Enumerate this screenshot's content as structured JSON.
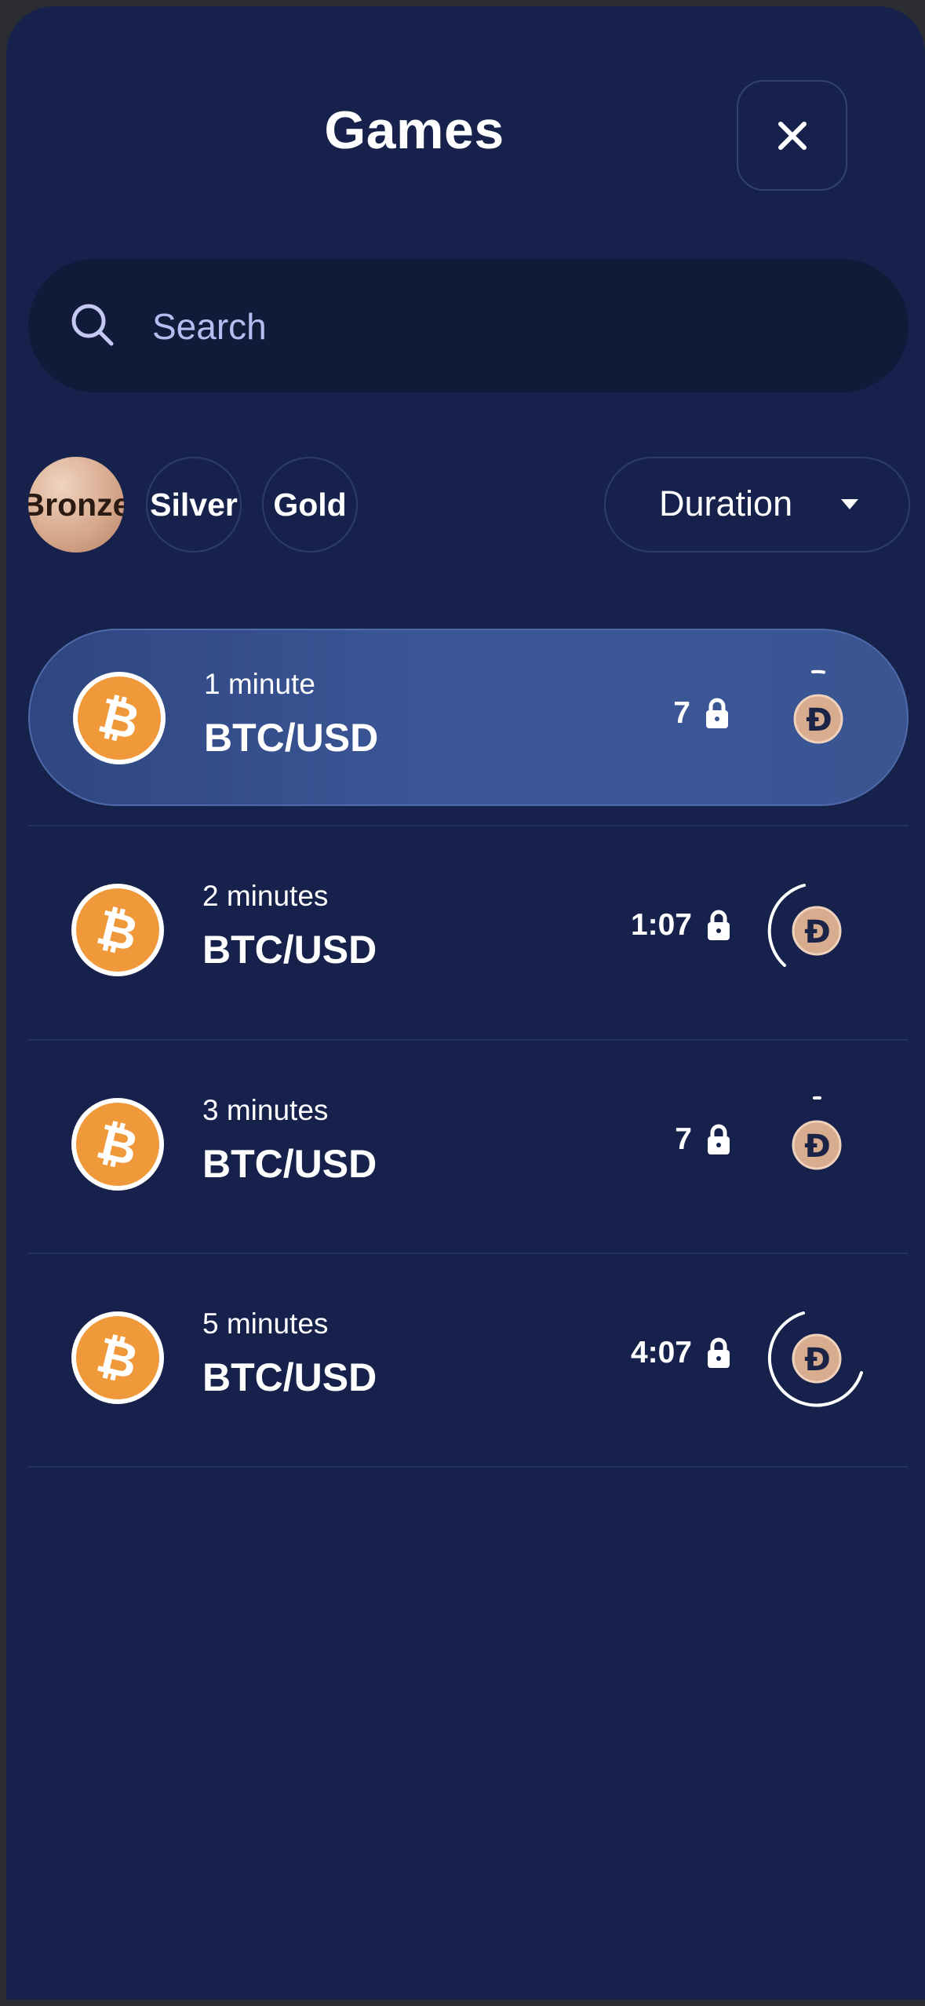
{
  "header": {
    "title": "Games",
    "close_icon": "close-icon"
  },
  "search": {
    "placeholder": "Search",
    "value": "",
    "icon": "search-icon"
  },
  "filters": {
    "tiers": [
      {
        "label": "Bronze",
        "selected": true
      },
      {
        "label": "Silver",
        "selected": false
      },
      {
        "label": "Gold",
        "selected": false
      }
    ],
    "duration": {
      "label": "Duration",
      "icon": "caret-down-icon"
    }
  },
  "games": [
    {
      "duration": "1 minute",
      "pair": "BTC/USD",
      "timer": "7",
      "coin_icon": "bitcoin-icon",
      "token_icon": "d-token-icon",
      "active": true
    },
    {
      "duration": "2 minutes",
      "pair": "BTC/USD",
      "timer": "1:07",
      "coin_icon": "bitcoin-icon",
      "token_icon": "d-token-icon",
      "active": false
    },
    {
      "duration": "3 minutes",
      "pair": "BTC/USD",
      "timer": "7",
      "coin_icon": "bitcoin-icon",
      "token_icon": "d-token-icon",
      "active": false
    },
    {
      "duration": "5 minutes",
      "pair": "BTC/USD",
      "timer": "4:07",
      "coin_icon": "bitcoin-icon",
      "token_icon": "d-token-icon",
      "active": false
    }
  ],
  "colors": {
    "background": "#16224c",
    "active_row": "#3b5696",
    "bitcoin": "#f0993a",
    "bronze": "#d7a98d",
    "text": "#ffffff"
  }
}
